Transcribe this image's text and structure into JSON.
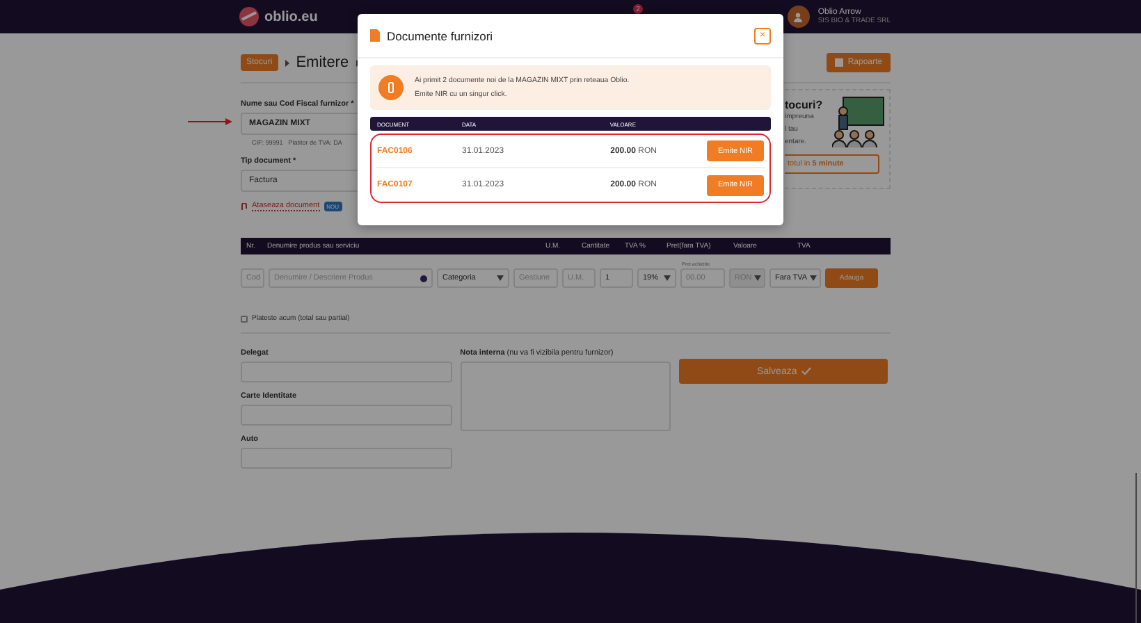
{
  "header": {
    "logo": "oblio.eu",
    "notification_count": "2",
    "user_name": "Oblio Arrow",
    "company": "SIS BIO & TRADE SRL"
  },
  "breadcrumb": [
    {
      "label": "Stocuri",
      "kind": "button"
    },
    {
      "label": "Emitere",
      "kind": "text"
    }
  ],
  "reports_button": "Rapoarte",
  "supplier": {
    "label": "Nume sau Cod Fiscal furnizor *",
    "value": "MAGAZIN MIXT",
    "cif": "CIF: 99991",
    "vat": "Platitor de TVA: DA"
  },
  "document_type": {
    "label": "Tip document *",
    "value": "Factura"
  },
  "attach": {
    "label": "Ataseaza document",
    "badge": "NOU"
  },
  "promo": {
    "lines": [
      "tocuri?",
      "impreuna",
      "l tau",
      "entare."
    ],
    "button": "totul in **5 minute**"
  },
  "products_table": {
    "columns": [
      "Nr.",
      "Denumire produs sau serviciu",
      "U.M.",
      "Cantitate",
      "TVA %",
      "Pret(fara TVA)",
      "Valoare",
      "TVA"
    ],
    "inputs": {
      "code": "Cod",
      "name": "Denumire / Descriere Produs",
      "category": "Categoria",
      "stock": "Gestiune",
      "unit": "U.M.",
      "quantity": "1",
      "vat": "19%",
      "price_label": "Pret achizitie",
      "price": "00.00",
      "currency": "RON",
      "vat_mode": "Fara TVA"
    },
    "add_button": "Adauga"
  },
  "pay_now": {
    "label": "Plateste acum (total sau partial)",
    "checked": false
  },
  "delegate_fields": [
    "Delegat",
    "Carte Identitate",
    "Auto"
  ],
  "note": {
    "label": "Nota interna",
    "hint": "(nu va fi vizibila pentru furnizor)"
  },
  "save_button": "Salveaza",
  "modal": {
    "title": "Documente furnizori",
    "close": "×",
    "message": [
      "Ai primit 2 documente noi de la MAGAZIN MIXT prin reteaua Oblio.",
      "Emite NIR cu un singur click."
    ],
    "columns": [
      "DOCUMENT",
      "DATA",
      "VALOARE"
    ],
    "rows": [
      {
        "document": "FAC0106",
        "date": "31.01.2023",
        "amount": "200.00",
        "currency": "RON",
        "action": "Emite NIR"
      },
      {
        "document": "FAC0107",
        "date": "31.01.2023",
        "amount": "200.00",
        "currency": "RON",
        "action": "Emite NIR"
      }
    ]
  }
}
